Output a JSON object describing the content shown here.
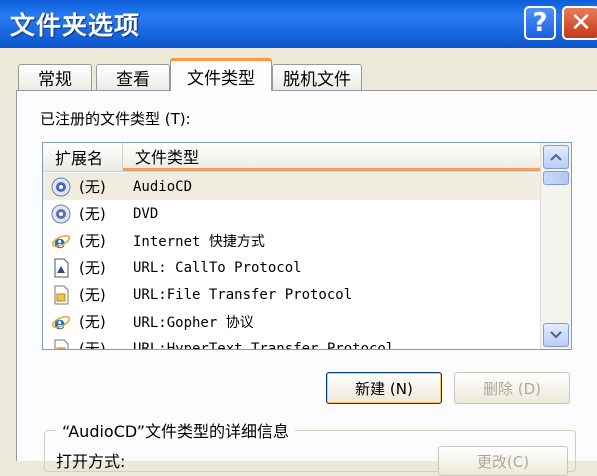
{
  "window": {
    "title": "文件夹选项"
  },
  "tabs": [
    {
      "label": "常规"
    },
    {
      "label": "查看"
    },
    {
      "label": "文件类型"
    },
    {
      "label": "脱机文件"
    }
  ],
  "file_types": {
    "label": "已注册的文件类型 (T):",
    "columns": {
      "extension": "扩展名",
      "type": "文件类型"
    },
    "rows": [
      {
        "ext": "(无)",
        "type": "AudioCD",
        "icon": "cd-audio-icon"
      },
      {
        "ext": "(无)",
        "type": "DVD",
        "icon": "dvd-icon"
      },
      {
        "ext": "(无)",
        "type": "Internet 快捷方式",
        "icon": "internet-explorer-icon"
      },
      {
        "ext": "(无)",
        "type": "URL: CallTo Protocol",
        "icon": "url-document-icon"
      },
      {
        "ext": "(无)",
        "type": "URL:File Transfer Protocol",
        "icon": "url-folder-icon"
      },
      {
        "ext": "(无)",
        "type": "URL:Gopher 协议",
        "icon": "internet-explorer-icon"
      },
      {
        "ext": "(无)",
        "type": "URL:HyperText Transfer Protocol",
        "icon": "url-folder-icon"
      }
    ]
  },
  "buttons": {
    "new": "新建 (N)",
    "delete": "删除 (D)",
    "change": "更改(C)"
  },
  "details": {
    "title": "“AudioCD”文件类型的详细信息",
    "open_with_label": "打开方式:"
  },
  "colors": {
    "title_bar": "#2a7bf1",
    "tab_accent": "#ff9a3a",
    "close_button": "#c4381a"
  }
}
